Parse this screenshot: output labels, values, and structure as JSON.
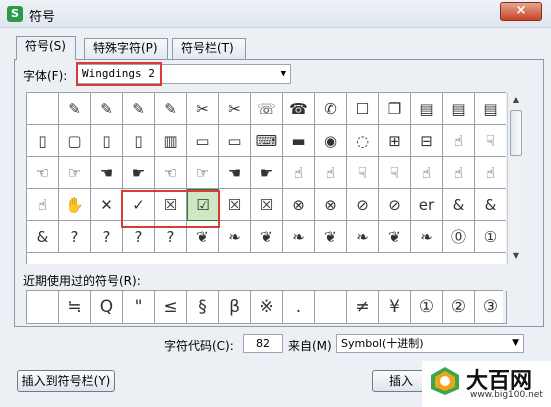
{
  "window": {
    "app_icon_letter": "S",
    "title": "符号",
    "close_label": "×"
  },
  "tabs": [
    {
      "label": "符号(S)"
    },
    {
      "label": "特殊字符(P)"
    },
    {
      "label": "符号栏(T)"
    }
  ],
  "font": {
    "label": "字体(F):",
    "value": "Wingdings 2"
  },
  "symbol_grid": {
    "rows": [
      [
        "",
        "✎",
        "✎",
        "✎",
        "✎",
        "✂",
        "✂",
        "☏",
        "☎",
        "✆",
        "☐",
        "❐",
        "▤",
        "▤",
        "▤"
      ],
      [
        "▯",
        "▢",
        "▯",
        "▯",
        "▥",
        "▭",
        "▭",
        "⌨",
        "▬",
        "◉",
        "◌",
        "⊞",
        "⊟",
        "☝",
        "☟"
      ],
      [
        "☜",
        "☞",
        "☚",
        "☛",
        "☜",
        "☞",
        "☚",
        "☛",
        "☝",
        "☝",
        "☟",
        "☟",
        "☝",
        "☝",
        "☝"
      ],
      [
        "☝",
        "✋",
        "✕",
        "✓",
        "☒",
        "☑",
        "☒",
        "☒",
        "⊗",
        "⊗",
        "⊘",
        "⊘",
        "er",
        "&",
        "&"
      ],
      [
        "&",
        "?",
        "?",
        "?",
        "?",
        "❦",
        "❧",
        "❦",
        "❧",
        "❦",
        "❧",
        "❦",
        "❧",
        "⓪",
        "①"
      ]
    ],
    "selected": {
      "row": 3,
      "col": 5
    }
  },
  "recent": {
    "label": "近期使用过的符号(R):",
    "items": [
      "",
      "≒",
      "Q",
      "\"",
      "≤",
      "§",
      "β",
      "※",
      ".",
      "",
      "≠",
      "¥",
      "①",
      "②",
      "③"
    ]
  },
  "char_code": {
    "label": "字符代码(C):",
    "value": "82"
  },
  "from": {
    "label": "来自(M)",
    "value": "Symbol(十进制)"
  },
  "buttons": {
    "insert_to_bar": "插入到符号栏(Y)",
    "insert": "插入"
  },
  "watermark": {
    "main": "大百网",
    "sub": "www.big100.net"
  },
  "colors": {
    "highlight": "#d93a3a",
    "selected_fill": "#cfe7c3",
    "logo_green": "#3aa84a"
  }
}
